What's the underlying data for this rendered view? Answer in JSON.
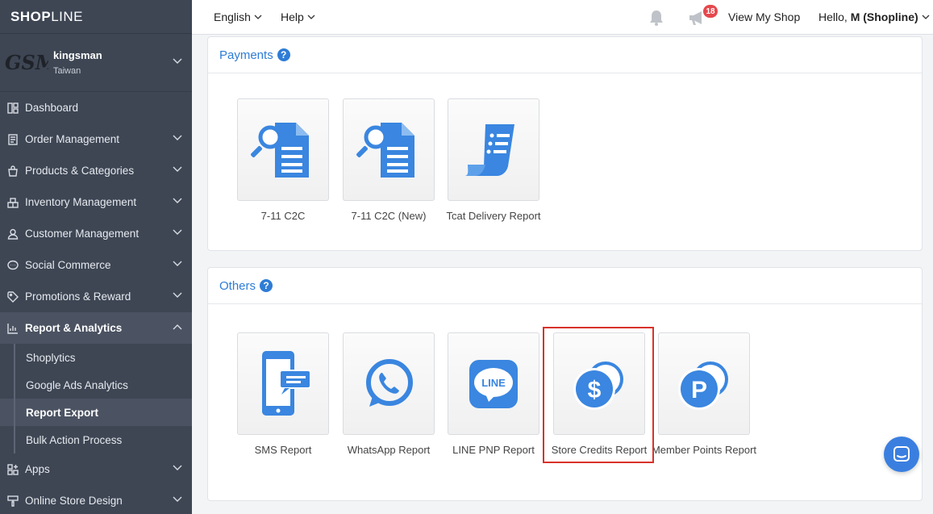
{
  "brand": {
    "bold": "SHOP",
    "light": "LINE"
  },
  "shop": {
    "logo_text": "GSM",
    "name": "kingsman",
    "country": "Taiwan"
  },
  "sidebar": {
    "items": [
      {
        "label": "Dashboard",
        "icon": "dashboard-icon"
      },
      {
        "label": "Order Management",
        "icon": "order-icon"
      },
      {
        "label": "Products & Categories",
        "icon": "bag-icon"
      },
      {
        "label": "Inventory Management",
        "icon": "inventory-icon"
      },
      {
        "label": "Customer Management",
        "icon": "user-icon"
      },
      {
        "label": "Social Commerce",
        "icon": "chat-bubble-icon"
      },
      {
        "label": "Promotions & Reward",
        "icon": "tag-icon"
      },
      {
        "label": "Report & Analytics",
        "icon": "chart-icon"
      }
    ],
    "sub_items": [
      "Shoplytics",
      "Google Ads Analytics",
      "Report Export",
      "Bulk Action Process"
    ],
    "after_items": [
      {
        "label": "Apps",
        "icon": "apps-icon"
      },
      {
        "label": "Online Store Design",
        "icon": "brush-icon"
      }
    ]
  },
  "topbar": {
    "language": "English",
    "help": "Help",
    "notification_count": "18",
    "view_shop": "View My Shop",
    "hello_prefix": "Hello,",
    "hello_user": "M (Shopline)"
  },
  "sections": {
    "payments": {
      "title": "Payments",
      "tiles": [
        "7-11 C2C",
        "7-11 C2C (New)",
        "Tcat Delivery Report"
      ]
    },
    "others": {
      "title": "Others",
      "tiles": [
        "SMS Report",
        "WhatsApp Report",
        "LINE PNP Report",
        "Store Credits Report",
        "Member Points Report"
      ]
    }
  },
  "icon_texts": {
    "line": "LINE",
    "dollar": "$",
    "points": "P"
  },
  "colors": {
    "accent": "#2e7cd6",
    "sidebar_bg": "#3e4654",
    "highlight": "#d8322a",
    "badge": "#e5484d"
  }
}
